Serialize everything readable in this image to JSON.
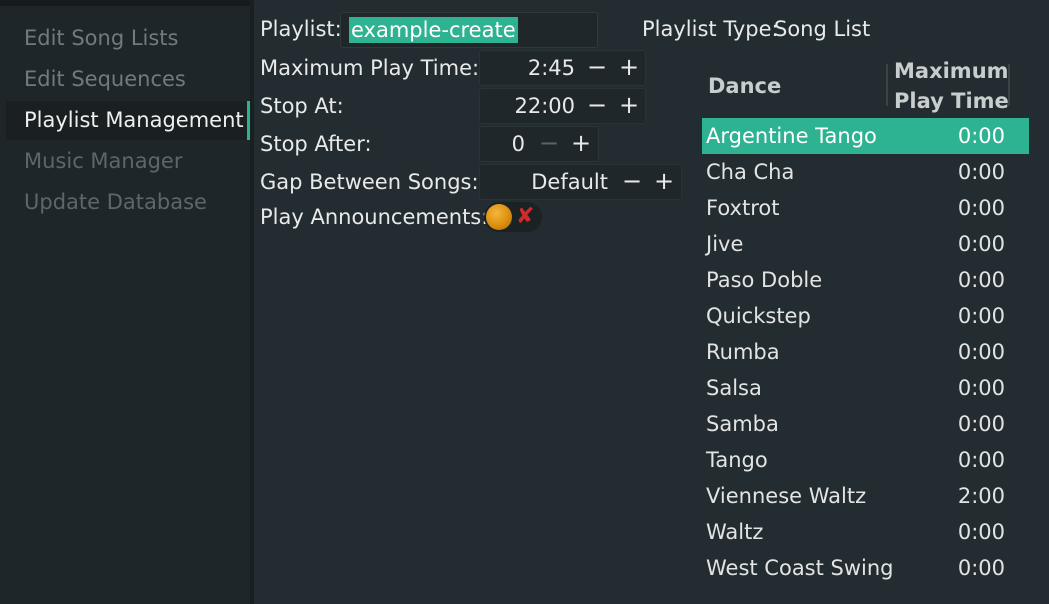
{
  "sidebar": {
    "items": [
      {
        "label": "Edit Song Lists"
      },
      {
        "label": "Edit Sequences"
      },
      {
        "label": "Playlist Management"
      },
      {
        "label": "Music Manager"
      },
      {
        "label": "Update Database"
      }
    ],
    "active_index": 2
  },
  "form": {
    "playlist_label": "Playlist:",
    "playlist_value": "example-create",
    "playlist_type_label": "Playlist Type:",
    "playlist_type_value": "Song List",
    "max_play_time_label": "Maximum Play Time:",
    "max_play_time_value": "2:45",
    "stop_at_label": "Stop At:",
    "stop_at_value": "22:00",
    "stop_after_label": "Stop After:",
    "stop_after_value": "0",
    "gap_label": "Gap Between Songs:",
    "gap_value": "Default",
    "announce_label": "Play Announcements:",
    "announce_enabled": false,
    "minus": "−",
    "plus": "+"
  },
  "dance_table": {
    "col_dance": "Dance",
    "col_time_line1": "Maximum",
    "col_time_line2": "Play Time",
    "rows": [
      {
        "dance": "Argentine Tango",
        "time": "0:00"
      },
      {
        "dance": "Cha Cha",
        "time": "0:00"
      },
      {
        "dance": "Foxtrot",
        "time": "0:00"
      },
      {
        "dance": "Jive",
        "time": "0:00"
      },
      {
        "dance": "Paso Doble",
        "time": "0:00"
      },
      {
        "dance": "Quickstep",
        "time": "0:00"
      },
      {
        "dance": "Rumba",
        "time": "0:00"
      },
      {
        "dance": "Salsa",
        "time": "0:00"
      },
      {
        "dance": "Samba",
        "time": "0:00"
      },
      {
        "dance": "Tango",
        "time": "0:00"
      },
      {
        "dance": "Viennese Waltz",
        "time": "2:00"
      },
      {
        "dance": "Waltz",
        "time": "0:00"
      },
      {
        "dance": "West Coast Swing",
        "time": "0:00"
      }
    ],
    "selected_index": 0
  },
  "colors": {
    "accent": "#2db391",
    "background": "#232c30",
    "sidebar": "#1e2629",
    "toggle_knob": "#e69a14",
    "toggle_off_mark": "#d22a2a"
  }
}
